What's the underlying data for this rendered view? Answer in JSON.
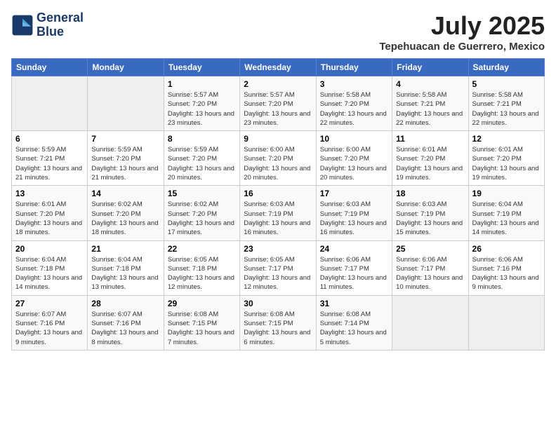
{
  "logo": {
    "line1": "General",
    "line2": "Blue"
  },
  "title": "July 2025",
  "subtitle": "Tepehuacan de Guerrero, Mexico",
  "days_of_week": [
    "Sunday",
    "Monday",
    "Tuesday",
    "Wednesday",
    "Thursday",
    "Friday",
    "Saturday"
  ],
  "weeks": [
    [
      {
        "num": "",
        "info": ""
      },
      {
        "num": "",
        "info": ""
      },
      {
        "num": "1",
        "info": "Sunrise: 5:57 AM\nSunset: 7:20 PM\nDaylight: 13 hours and 23 minutes."
      },
      {
        "num": "2",
        "info": "Sunrise: 5:57 AM\nSunset: 7:20 PM\nDaylight: 13 hours and 23 minutes."
      },
      {
        "num": "3",
        "info": "Sunrise: 5:58 AM\nSunset: 7:20 PM\nDaylight: 13 hours and 22 minutes."
      },
      {
        "num": "4",
        "info": "Sunrise: 5:58 AM\nSunset: 7:21 PM\nDaylight: 13 hours and 22 minutes."
      },
      {
        "num": "5",
        "info": "Sunrise: 5:58 AM\nSunset: 7:21 PM\nDaylight: 13 hours and 22 minutes."
      }
    ],
    [
      {
        "num": "6",
        "info": "Sunrise: 5:59 AM\nSunset: 7:21 PM\nDaylight: 13 hours and 21 minutes."
      },
      {
        "num": "7",
        "info": "Sunrise: 5:59 AM\nSunset: 7:20 PM\nDaylight: 13 hours and 21 minutes."
      },
      {
        "num": "8",
        "info": "Sunrise: 5:59 AM\nSunset: 7:20 PM\nDaylight: 13 hours and 20 minutes."
      },
      {
        "num": "9",
        "info": "Sunrise: 6:00 AM\nSunset: 7:20 PM\nDaylight: 13 hours and 20 minutes."
      },
      {
        "num": "10",
        "info": "Sunrise: 6:00 AM\nSunset: 7:20 PM\nDaylight: 13 hours and 20 minutes."
      },
      {
        "num": "11",
        "info": "Sunrise: 6:01 AM\nSunset: 7:20 PM\nDaylight: 13 hours and 19 minutes."
      },
      {
        "num": "12",
        "info": "Sunrise: 6:01 AM\nSunset: 7:20 PM\nDaylight: 13 hours and 19 minutes."
      }
    ],
    [
      {
        "num": "13",
        "info": "Sunrise: 6:01 AM\nSunset: 7:20 PM\nDaylight: 13 hours and 18 minutes."
      },
      {
        "num": "14",
        "info": "Sunrise: 6:02 AM\nSunset: 7:20 PM\nDaylight: 13 hours and 18 minutes."
      },
      {
        "num": "15",
        "info": "Sunrise: 6:02 AM\nSunset: 7:20 PM\nDaylight: 13 hours and 17 minutes."
      },
      {
        "num": "16",
        "info": "Sunrise: 6:03 AM\nSunset: 7:19 PM\nDaylight: 13 hours and 16 minutes."
      },
      {
        "num": "17",
        "info": "Sunrise: 6:03 AM\nSunset: 7:19 PM\nDaylight: 13 hours and 16 minutes."
      },
      {
        "num": "18",
        "info": "Sunrise: 6:03 AM\nSunset: 7:19 PM\nDaylight: 13 hours and 15 minutes."
      },
      {
        "num": "19",
        "info": "Sunrise: 6:04 AM\nSunset: 7:19 PM\nDaylight: 13 hours and 14 minutes."
      }
    ],
    [
      {
        "num": "20",
        "info": "Sunrise: 6:04 AM\nSunset: 7:18 PM\nDaylight: 13 hours and 14 minutes."
      },
      {
        "num": "21",
        "info": "Sunrise: 6:04 AM\nSunset: 7:18 PM\nDaylight: 13 hours and 13 minutes."
      },
      {
        "num": "22",
        "info": "Sunrise: 6:05 AM\nSunset: 7:18 PM\nDaylight: 13 hours and 12 minutes."
      },
      {
        "num": "23",
        "info": "Sunrise: 6:05 AM\nSunset: 7:17 PM\nDaylight: 13 hours and 12 minutes."
      },
      {
        "num": "24",
        "info": "Sunrise: 6:06 AM\nSunset: 7:17 PM\nDaylight: 13 hours and 11 minutes."
      },
      {
        "num": "25",
        "info": "Sunrise: 6:06 AM\nSunset: 7:17 PM\nDaylight: 13 hours and 10 minutes."
      },
      {
        "num": "26",
        "info": "Sunrise: 6:06 AM\nSunset: 7:16 PM\nDaylight: 13 hours and 9 minutes."
      }
    ],
    [
      {
        "num": "27",
        "info": "Sunrise: 6:07 AM\nSunset: 7:16 PM\nDaylight: 13 hours and 9 minutes."
      },
      {
        "num": "28",
        "info": "Sunrise: 6:07 AM\nSunset: 7:16 PM\nDaylight: 13 hours and 8 minutes."
      },
      {
        "num": "29",
        "info": "Sunrise: 6:08 AM\nSunset: 7:15 PM\nDaylight: 13 hours and 7 minutes."
      },
      {
        "num": "30",
        "info": "Sunrise: 6:08 AM\nSunset: 7:15 PM\nDaylight: 13 hours and 6 minutes."
      },
      {
        "num": "31",
        "info": "Sunrise: 6:08 AM\nSunset: 7:14 PM\nDaylight: 13 hours and 5 minutes."
      },
      {
        "num": "",
        "info": ""
      },
      {
        "num": "",
        "info": ""
      }
    ]
  ]
}
